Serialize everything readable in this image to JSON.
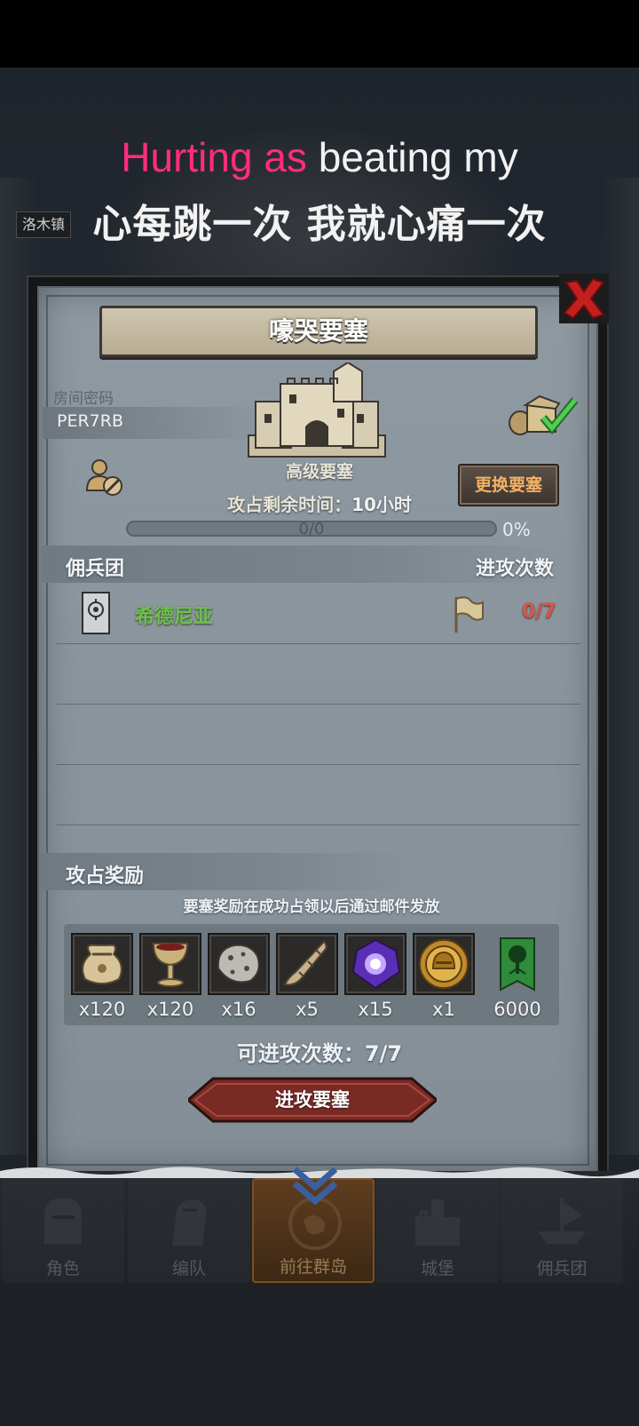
{
  "lyrics": {
    "english_highlight": "Hurting as",
    "english_rest": "beating my",
    "chinese": "心每跳一次 我就心痛一次",
    "highlight_color": "#ff2d7a"
  },
  "background": {
    "map_label": "洛木镇"
  },
  "panel": {
    "title": "嚎哭要塞",
    "room_code_label": "房间密码",
    "room_code": "PER7RB",
    "fortress_type": "高级要塞",
    "swap_button": "更换要塞",
    "remaining_label": "攻占剩余时间：",
    "remaining_value": "10小时",
    "progress": {
      "text": "0/0",
      "percent_text": "0%",
      "fraction": 0
    }
  },
  "mercenary_section": {
    "title": "佣兵团",
    "attack_header": "进攻次数",
    "rows": [
      {
        "name": "希德尼亚",
        "attacks": "0/7",
        "name_color": "#6fc04f",
        "count_color": "#d6554a"
      }
    ]
  },
  "reward_section": {
    "title": "攻占奖励",
    "note": "要塞奖励在成功占领以后通过邮件发放",
    "items": [
      {
        "icon": "coin-bag-icon",
        "qty": "x120"
      },
      {
        "icon": "goblet-icon",
        "qty": "x120"
      },
      {
        "icon": "ore-rock-icon",
        "qty": "x16"
      },
      {
        "icon": "horn-icon",
        "qty": "x5"
      },
      {
        "icon": "purple-gem-icon",
        "qty": "x15"
      },
      {
        "icon": "gold-helmet-medal-icon",
        "qty": "x1"
      },
      {
        "icon": "green-tree-banner-icon",
        "qty": "6000"
      }
    ]
  },
  "attempts": {
    "label": "可进攻次数：",
    "value": "7/7"
  },
  "attack_button": "进攻要塞",
  "bottom_nav": [
    {
      "label": "角色",
      "icon": "helmet-icon",
      "active": false
    },
    {
      "label": "编队",
      "icon": "knight-icon",
      "active": false
    },
    {
      "label": "前往群岛",
      "icon": "compass-map-icon",
      "active": true
    },
    {
      "label": "城堡",
      "icon": "castle-icon",
      "active": false
    },
    {
      "label": "佣兵团",
      "icon": "ship-icon",
      "active": false
    }
  ]
}
